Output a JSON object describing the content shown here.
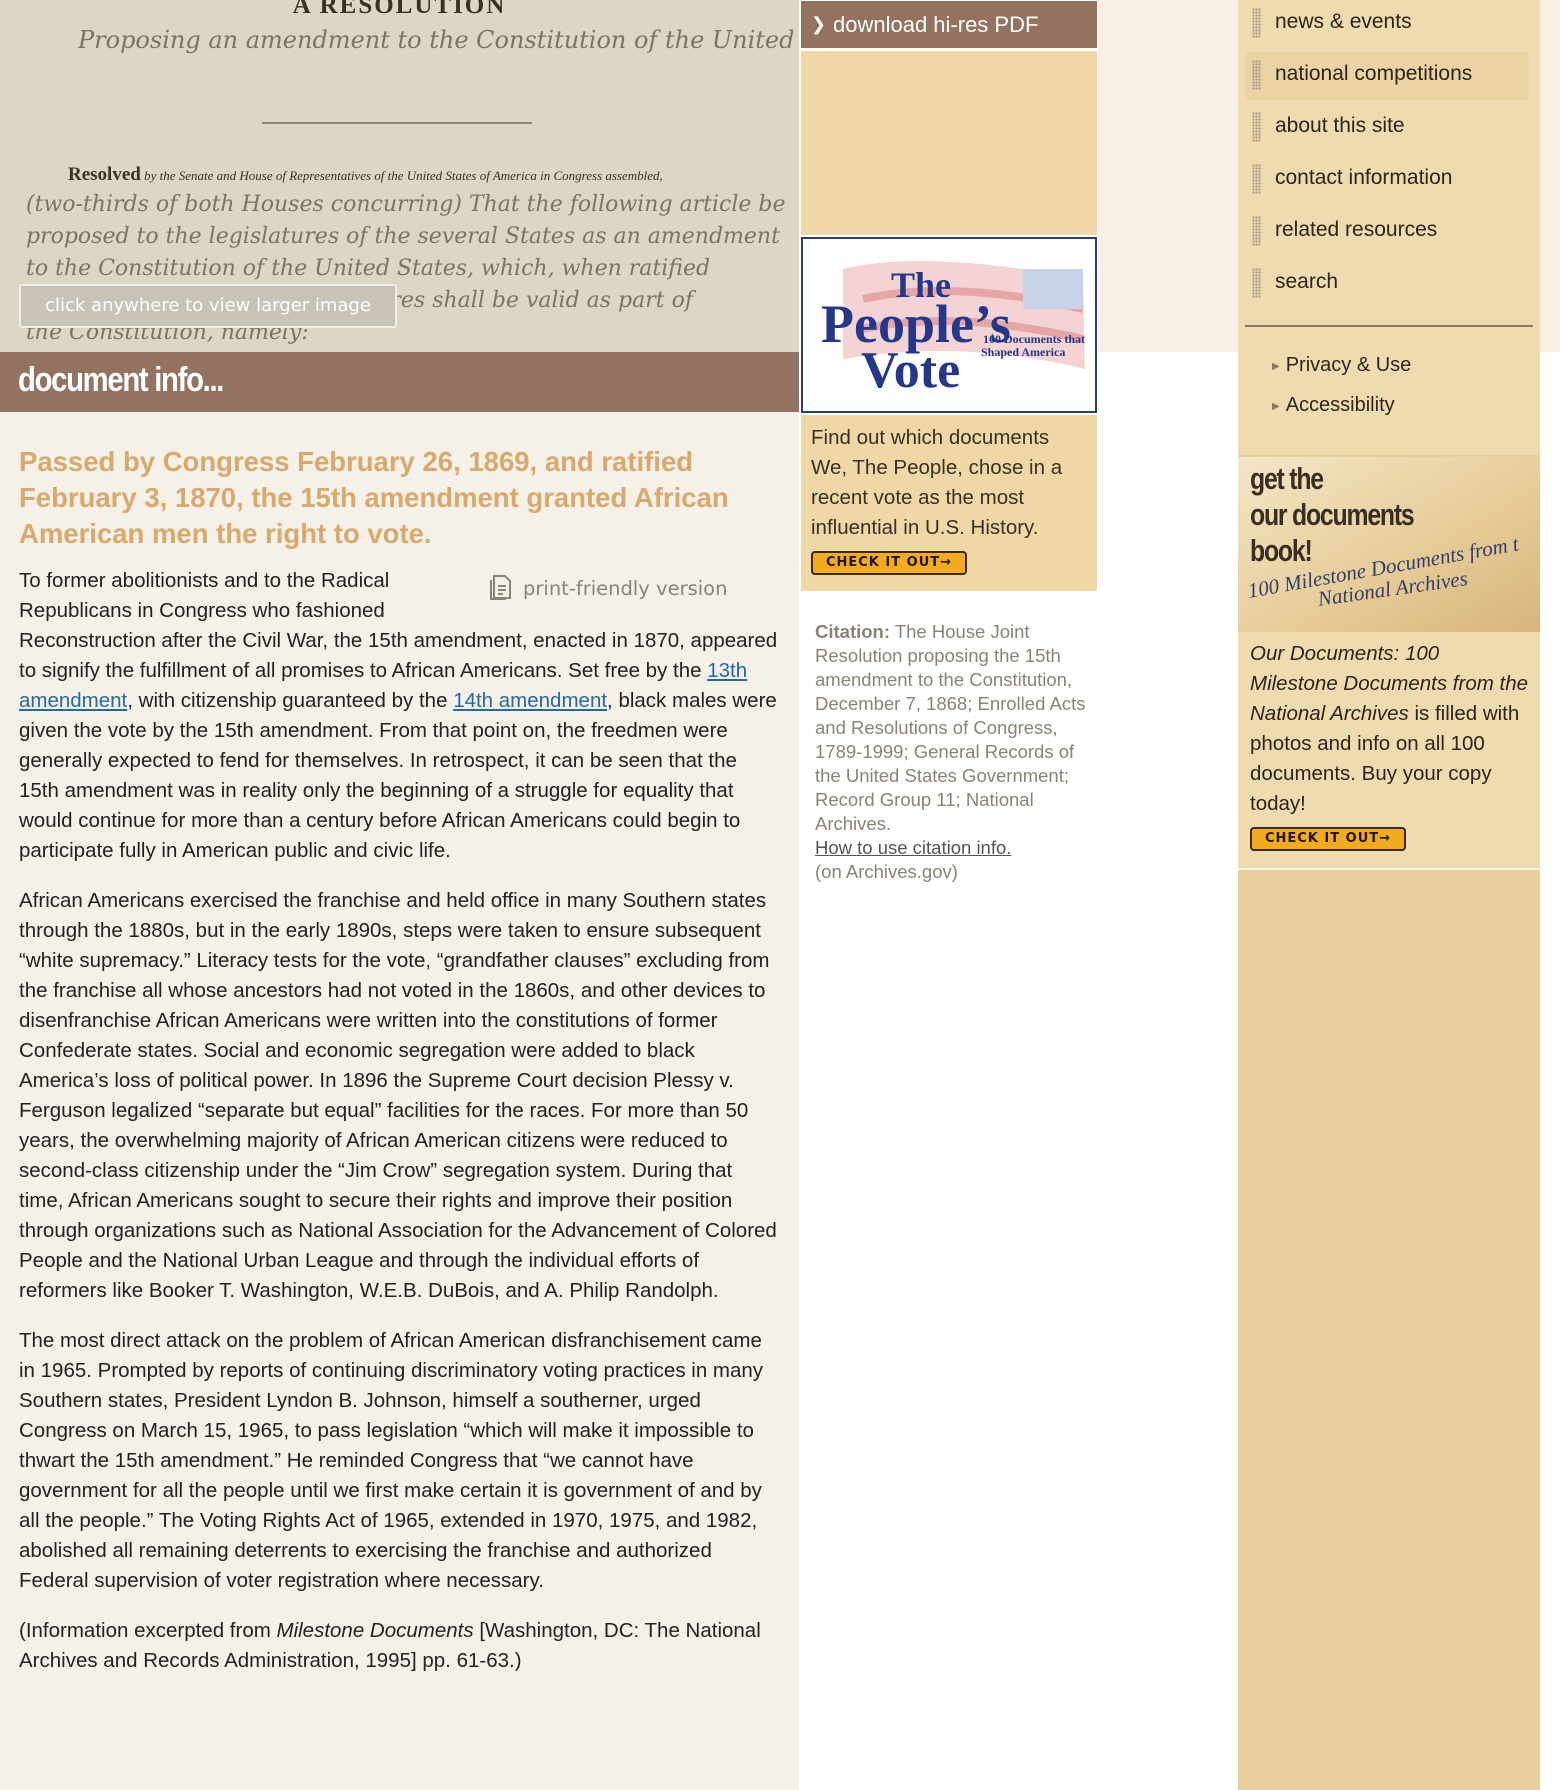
{
  "document_image": {
    "heading": "A RESOLUTION",
    "script_line1": "Proposing an amendment to the Constitution of the United",
    "resolved_word": "Resolved",
    "resolved_text": "by the Senate and House of Representatives of the United States of America in Congress assembled,",
    "handwriting": [
      "(two-thirds of both Houses concurring) That the following article be",
      "proposed to the legislatures of the several States as an amendment",
      "to the Constitution of the United States, which, when ratified",
      "by three-fourths of said legislatures shall be valid as part of",
      "the Constitution, namely:"
    ],
    "enlarge_label": "click anywhere to view larger image"
  },
  "docinfo": {
    "title": "document info..."
  },
  "content": {
    "headline": "Passed by Congress February 26, 1869, and ratified February 3, 1870, the 15th amendment granted African American men the right to vote.",
    "print_link": "print-friendly version",
    "p1": {
      "a": "To former abolitionists and to the Radical Republicans in Congress who fashioned Reconstruction after the Civil War, the 15th amendment, enacted in 1870, appeared to signify the fulfillment of all promises to African Americans. Set free by the ",
      "link1": "13th amendment",
      "b": ", with citizenship guaranteed by the ",
      "link2": "14th amendment",
      "c": ", black males were given the vote by the 15th amendment. From that point on, the freedmen were generally expected to fend for themselves. In retrospect, it can be seen that the 15th amendment was in reality only the beginning of a struggle for equality that would continue for more than a century before African Americans could begin to participate fully in American public and civic life."
    },
    "p2": "African Americans exercised the franchise and held office in many Southern states through the 1880s, but in the early 1890s, steps were taken to ensure subsequent “white supremacy.” Literacy tests for the vote, “grandfather clauses” excluding from the franchise all whose ancestors had not voted in the 1860s, and other devices to disenfranchise African Americans were written into the constitutions of former Confederate states. Social and economic segregation were added to black America’s loss of political power. In 1896 the Supreme Court decision Plessy v. Ferguson legalized “separate but equal” facilities for the races. For more than 50 years, the overwhelming majority of African American citizens were reduced to second-class citizenship under the “Jim Crow” segregation system. During that time, African Americans sought to secure their rights and improve their position through organizations such as National Association for the Advancement of Colored People and the National Urban League and through the individual efforts of reformers like Booker T. Washington, W.E.B. DuBois, and A. Philip Randolph.",
    "p3": "The most direct attack on the problem of African American disfranchisement came in 1965. Prompted by reports of continuing discriminatory voting practices in many Southern states, President Lyndon B. Johnson, himself a southerner, urged Congress on March 15, 1965, to pass legislation “which will make it impossible to thwart the 15th amendment.” He reminded Congress that “we cannot have government for all the people until we first make certain it is government of and by all the people.” The Voting Rights Act of 1965, extended in 1970, 1975, and 1982, abolished all remaining deterrents to exercising the franchise and authorized Federal supervision of voter registration where necessary.",
    "p4": {
      "a": "(Information excerpted from ",
      "em": "Milestone Documents",
      "b": " [Washington, DC: The National Archives and Records Administration, 1995] pp. 61-63.)"
    }
  },
  "middle": {
    "download_label": "download hi-res PDF",
    "peoples_vote_logo": {
      "the": "The",
      "peoples": "People’s",
      "vote": "Vote",
      "tagline1": "100 Documents that",
      "tagline2": "Shaped America"
    },
    "promo_text": "Find out which documents We, The People, chose in a recent vote as the most influential in U.S. History.",
    "check_it_out": "CHECK IT OUT→",
    "citation": {
      "label": "Citation:",
      "text": " The House Joint Resolution proposing the 15th amendment to the Constitution, December 7, 1868; Enrolled Acts and Resolutions of Congress, 1789-1999; General Records of the United States Government; Record Group 11; National Archives.",
      "link": "How to use citation info.",
      "suffix": "(on Archives.gov)"
    }
  },
  "nav": {
    "items": [
      {
        "label": "news & events"
      },
      {
        "label": "national competitions"
      },
      {
        "label": "about this site"
      },
      {
        "label": "contact information"
      },
      {
        "label": "related resources"
      },
      {
        "label": "search"
      }
    ],
    "sub_links": [
      {
        "label": "Privacy & Use"
      },
      {
        "label": "Accessibility"
      }
    ]
  },
  "book": {
    "banner_line1": "get the",
    "banner_line2": "our documents",
    "banner_line3": "book!",
    "banner_sub1": "100 Milestone Documents from t",
    "banner_sub2": "National Archives",
    "italic_text": "Our Documents: 100 Milestone Documents from the National Archives",
    "text": " is filled with photos and info on all 100 documents. Buy your copy today!",
    "check_it_out": "CHECK IT OUT→"
  },
  "colors": {
    "accent_brown": "#947260",
    "headline_gold": "#d9a86b",
    "tan_panel": "#efd7a6",
    "link_blue": "#2468a8",
    "button_orange": "#f2ab1e"
  }
}
